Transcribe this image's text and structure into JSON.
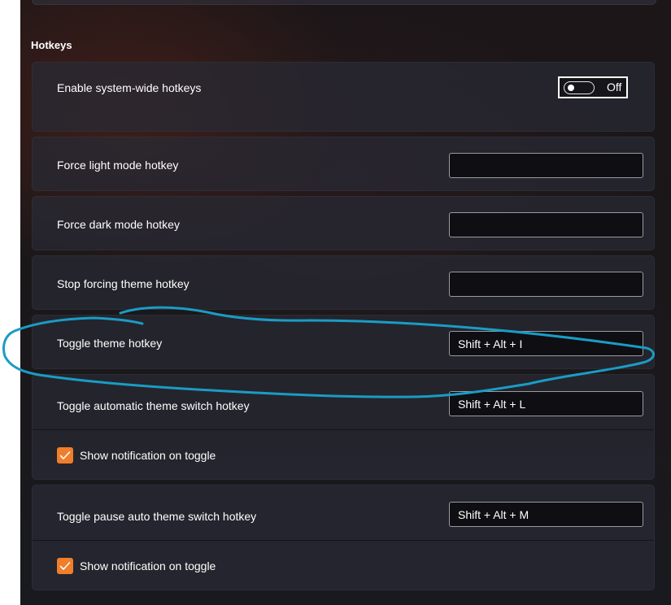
{
  "section": {
    "title": "Hotkeys"
  },
  "enable_hotkeys": {
    "label": "Enable system-wide hotkeys",
    "toggle_state": "Off"
  },
  "hotkeys": [
    {
      "label": "Force light mode hotkey",
      "value": ""
    },
    {
      "label": "Force dark mode hotkey",
      "value": ""
    },
    {
      "label": "Stop forcing theme hotkey",
      "value": ""
    },
    {
      "label": "Toggle theme hotkey",
      "value": "Shift + Alt + I"
    },
    {
      "label": "Toggle automatic theme switch hotkey",
      "value": "Shift + Alt + L",
      "checkbox_label": "Show notification on toggle",
      "checked": true
    },
    {
      "label": "Toggle pause auto theme switch hotkey",
      "value": "Shift + Alt + M",
      "checkbox_label": "Show notification on toggle",
      "checked": true
    }
  ],
  "colors": {
    "accent": "#f07e2a",
    "annotation": "#1a9cc4"
  }
}
